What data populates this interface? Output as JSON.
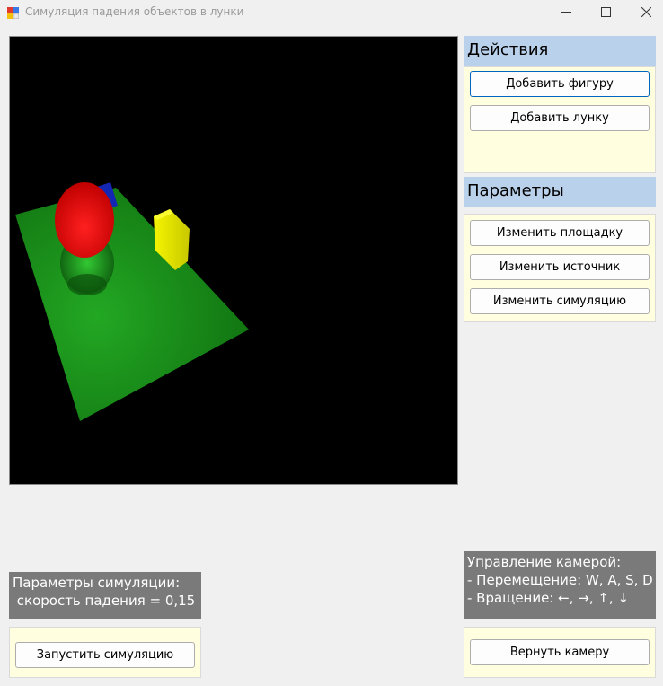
{
  "window": {
    "title": "Симуляция падения объектов в лунки",
    "icon": "winforms-app-icon",
    "controls": [
      "minimize-icon",
      "maximize-icon",
      "close-icon"
    ]
  },
  "scene": {
    "background": "#000000",
    "platform_color": "#1a8a1a",
    "objects": [
      {
        "name": "red-sphere",
        "color": "#ff1010"
      },
      {
        "name": "yellow-box",
        "color": "#e0e000"
      },
      {
        "name": "blue-box",
        "color": "#1020c0"
      }
    ]
  },
  "actions": {
    "header": "Действия",
    "add_shape": "Добавить фигуру",
    "add_hole": "Добавить лунку"
  },
  "parameters": {
    "header": "Параметры",
    "change_platform": "Изменить площадку",
    "change_source": "Изменить источник",
    "change_simulation": "Изменить симуляцию"
  },
  "simulation_info": {
    "line1": "Параметры симуляции:",
    "line2": " скорость падения = 0,15",
    "start_button": "Запустить симуляцию"
  },
  "camera_info": {
    "line1": "Управление камерой:",
    "line2": "- Перемещение: W, A, S, D",
    "line3": "- Вращение: ←, →, ↑, ↓",
    "reset_button": "Вернуть камеру"
  },
  "colors": {
    "panel_header": "#b9d1ea",
    "panel_body": "#ffffe0",
    "info_label": "#7a7a7a",
    "focus_border": "#0067c0"
  }
}
